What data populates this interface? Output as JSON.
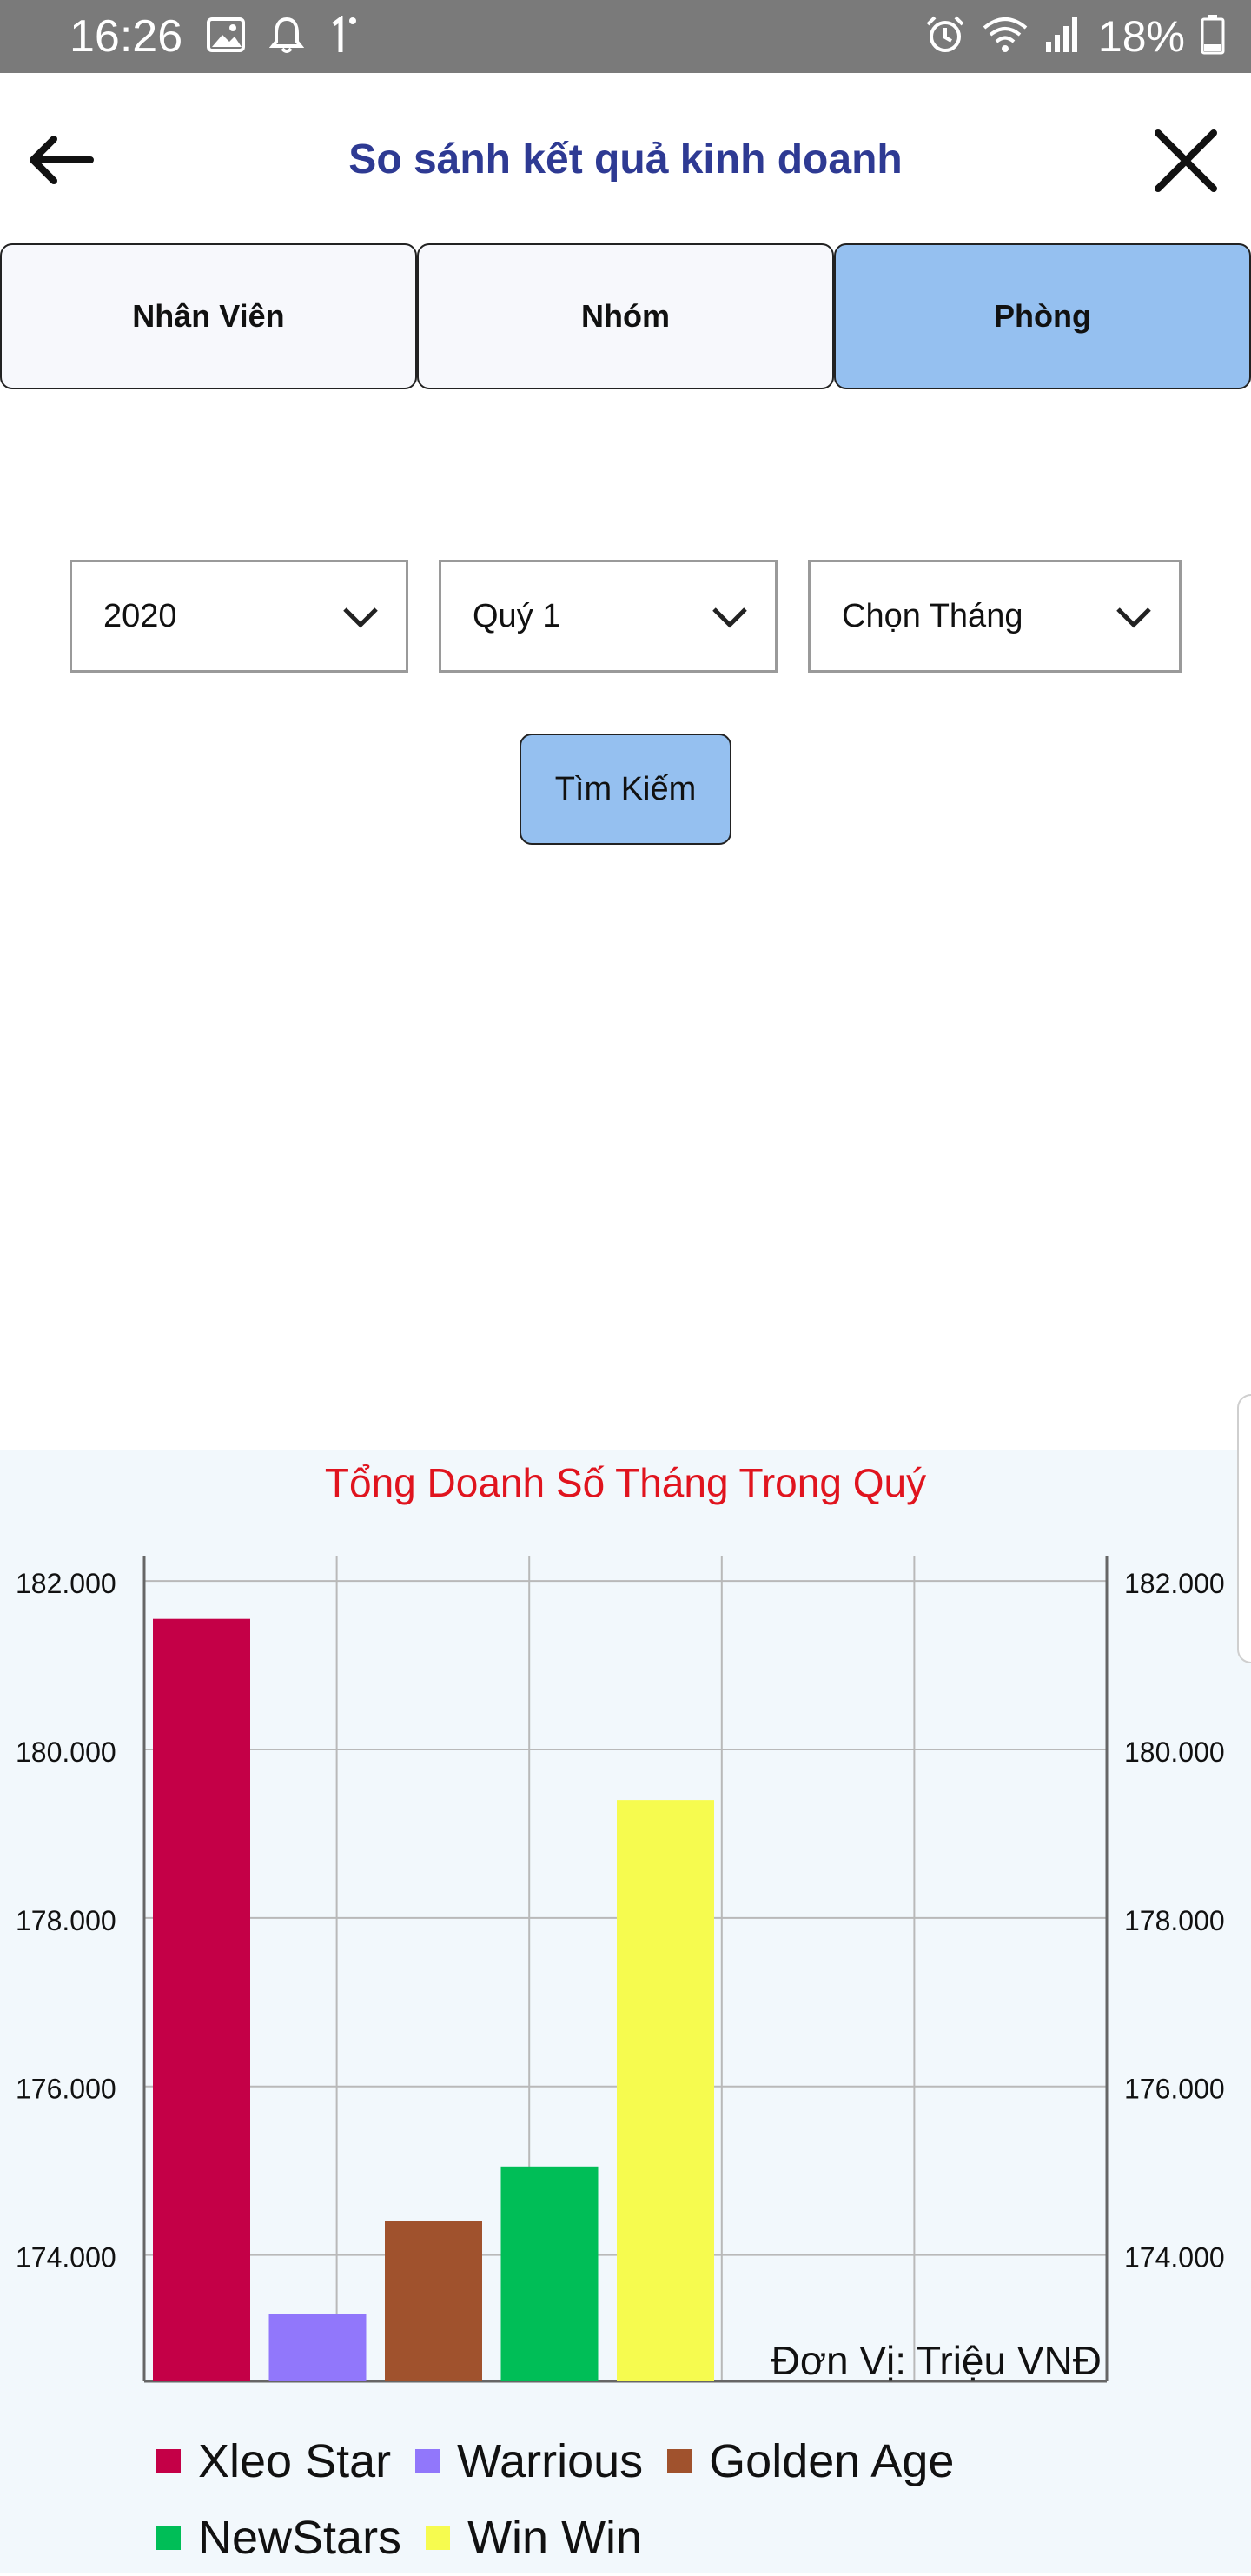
{
  "status_bar": {
    "time": "16:26",
    "left_icons": [
      "image-icon",
      "bell-icon",
      "notification-count-icon"
    ],
    "right_icons": [
      "alarm-icon",
      "wifi-icon",
      "signal-icon",
      "battery-icon"
    ],
    "battery_percent": "18%"
  },
  "header": {
    "title": "So sánh kết quả kinh doanh",
    "back_icon": "arrow-left-icon",
    "close_icon": "close-icon"
  },
  "tabs": [
    {
      "label": "Nhân Viên",
      "active": false
    },
    {
      "label": "Nhóm",
      "active": false
    },
    {
      "label": "Phòng",
      "active": true
    }
  ],
  "filters": {
    "year": "2020",
    "quarter": "Quý 1",
    "month": "Chọn Tháng"
  },
  "search_button": "Tìm Kiếm",
  "colors": {
    "title": "#2e3a93",
    "active_tab": "#95c0f0",
    "chart_title": "#e0141e"
  },
  "chart_data": {
    "type": "bar",
    "title": "Tổng Doanh Số Tháng Trong Quý",
    "unit_label": "Đơn Vị: Triệu VNĐ",
    "ylim": [
      172.5,
      182.3
    ],
    "yticks": [
      174.0,
      176.0,
      178.0,
      180.0,
      182.0
    ],
    "ytick_labels": [
      "174.000",
      "176.000",
      "178.000",
      "180.000",
      "182.000"
    ],
    "grid": true,
    "legend_position": "bottom",
    "series": [
      {
        "name": "Xleo Star",
        "value": 181.55,
        "color": "#c40047"
      },
      {
        "name": "Warrious",
        "value": 173.3,
        "color": "#9177fb"
      },
      {
        "name": "Golden Age",
        "value": 174.4,
        "color": "#a0522d"
      },
      {
        "name": "NewStars",
        "value": 175.05,
        "color": "#00be57"
      },
      {
        "name": "Win Win",
        "value": 179.4,
        "color": "#f6fb4f"
      }
    ]
  }
}
